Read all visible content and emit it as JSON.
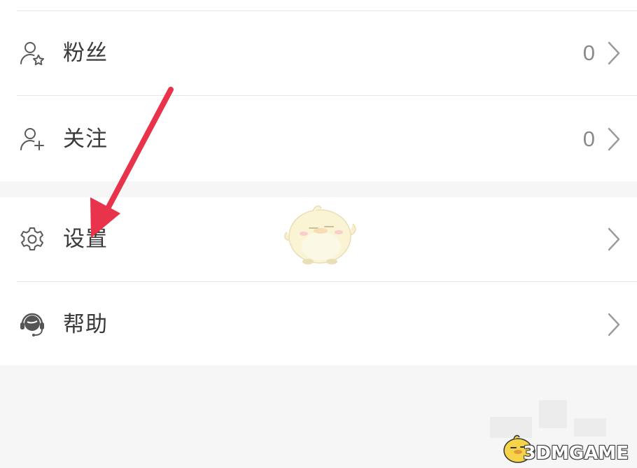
{
  "menu": {
    "fans": {
      "label": "粉丝",
      "count": "0"
    },
    "follow": {
      "label": "关注",
      "count": "0"
    },
    "settings": {
      "label": "设置"
    },
    "help": {
      "label": "帮助"
    }
  },
  "watermark": {
    "text": "3DMGAME"
  },
  "colors": {
    "arrow": "#e8334a",
    "divider": "#e7e7e7",
    "background": "#f6f6f6",
    "label": "#3a3a3a",
    "muted": "#8a8a8a"
  }
}
